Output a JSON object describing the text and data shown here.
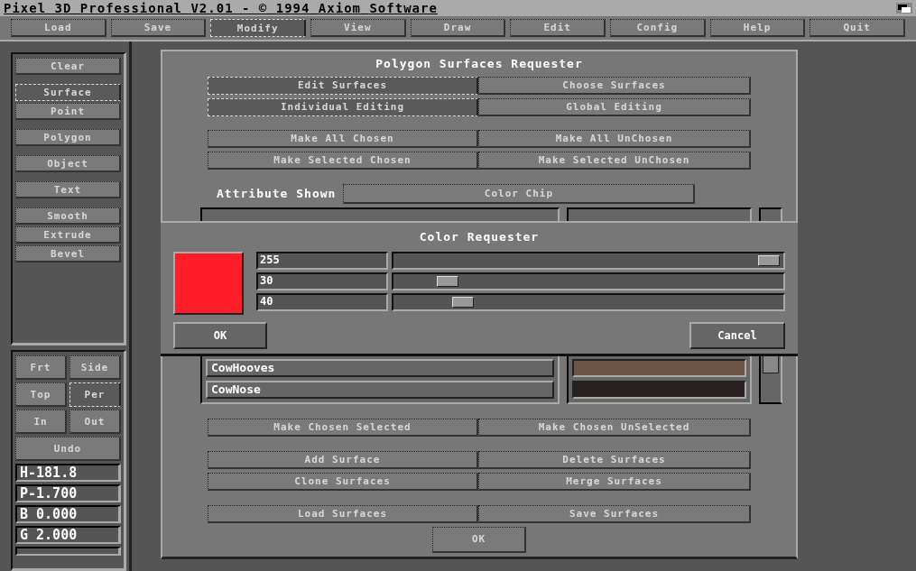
{
  "window": {
    "title": "Pixel 3D Professional V2.01 - © 1994 Axiom Software"
  },
  "menu": [
    {
      "label": "Load",
      "selected": false
    },
    {
      "label": "Save",
      "selected": false
    },
    {
      "label": "Modify",
      "selected": true
    },
    {
      "label": "View",
      "selected": false
    },
    {
      "label": "Draw",
      "selected": false
    },
    {
      "label": "Edit",
      "selected": false
    },
    {
      "label": "Config",
      "selected": false
    },
    {
      "label": "Help",
      "selected": false
    },
    {
      "label": "Quit",
      "selected": false
    }
  ],
  "sidebar": {
    "groups": [
      [
        {
          "label": "Clear",
          "selected": false
        }
      ],
      [
        {
          "label": "Surface",
          "selected": true
        },
        {
          "label": "Point",
          "selected": false
        }
      ],
      [
        {
          "label": "Polygon",
          "selected": false
        }
      ],
      [
        {
          "label": "Object",
          "selected": false
        }
      ],
      [
        {
          "label": "Text",
          "selected": false
        }
      ],
      [
        {
          "label": "Smooth",
          "selected": false
        },
        {
          "label": "Extrude",
          "selected": false
        },
        {
          "label": "Bevel",
          "selected": false
        }
      ]
    ]
  },
  "views": [
    {
      "label": "Frt",
      "kind": "angle",
      "selected": false
    },
    {
      "label": "Side",
      "kind": "angle",
      "selected": false
    },
    {
      "label": "Top",
      "kind": "angle",
      "selected": false
    },
    {
      "label": "Per",
      "kind": "angle",
      "selected": true
    },
    {
      "label": "In",
      "kind": "zoom",
      "selected": false
    },
    {
      "label": "Out",
      "kind": "zoom",
      "selected": false
    },
    {
      "label": "Undo",
      "kind": "undo",
      "selected": false
    }
  ],
  "readouts": [
    "H-181.8",
    "P-1.700",
    "B 0.000",
    "G 2.000"
  ],
  "dialog": {
    "title": "Polygon Surfaces Requester",
    "mode_rows": [
      [
        {
          "label": "Edit Surfaces",
          "selected": true
        },
        {
          "label": "Choose Surfaces",
          "selected": false
        }
      ],
      [
        {
          "label": "Individual Editing",
          "selected": true
        },
        {
          "label": "Global Editing",
          "selected": false
        }
      ]
    ],
    "choose_rows": [
      [
        "Make All Chosen",
        "Make All UnChosen"
      ],
      [
        "Make Selected Chosen",
        "Make Selected UnChosen"
      ]
    ],
    "attribute_label": "Attribute Shown",
    "attribute_value": "Color Chip",
    "surfaces": [
      {
        "name": "CowHooves",
        "color": "#6b5443"
      },
      {
        "name": "CowNose",
        "color": "#2a2020"
      }
    ],
    "select_rows": [
      [
        "Make Chosen Selected",
        "Make Chosen UnSelected"
      ]
    ],
    "edit_rows": [
      [
        "Add Surface",
        "Delete Surfaces"
      ],
      [
        "Clone Surfaces",
        "Merge Surfaces"
      ]
    ],
    "file_rows": [
      [
        "Load Surfaces",
        "Save Surfaces"
      ]
    ],
    "ok": "OK"
  },
  "color_requester": {
    "title": "Color Requester",
    "swatch": {
      "color": "#ff1e2a"
    },
    "channels": [
      {
        "value": "255",
        "level": 1.0
      },
      {
        "value": "30",
        "level": 0.12
      },
      {
        "value": "40",
        "level": 0.16
      }
    ],
    "ok": "OK",
    "cancel": "Cancel"
  }
}
